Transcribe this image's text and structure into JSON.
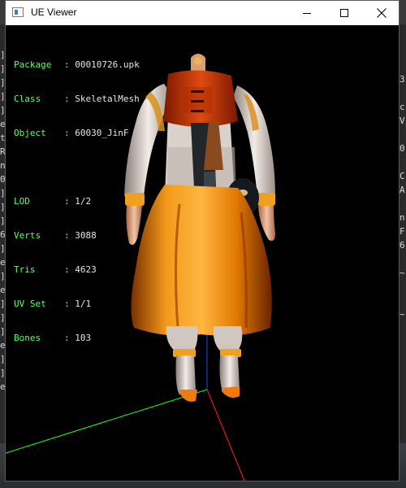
{
  "window": {
    "title": "UE Viewer"
  },
  "info": {
    "rows": [
      {
        "key": "Package",
        "value": "00010726.upk"
      },
      {
        "key": "Class",
        "value": "SkeletalMesh"
      },
      {
        "key": "Object",
        "value": "60030_JinF"
      }
    ],
    "stats": [
      {
        "key": "LOD",
        "value": "1/2"
      },
      {
        "key": "Verts",
        "value": "3088"
      },
      {
        "key": "Tris",
        "value": "4623"
      },
      {
        "key": "UV Set",
        "value": "1/1"
      },
      {
        "key": "Bones",
        "value": "103"
      }
    ]
  },
  "background_console": {
    "left_glyphs": [
      "]",
      "]",
      "]",
      "]",
      "]",
      "e",
      "t",
      "R",
      "n",
      "0",
      "]",
      "]",
      "]",
      "6",
      "]",
      "e",
      "]",
      "e",
      "]",
      "]",
      "]",
      "e",
      "]",
      "]",
      "e"
    ],
    "right_glyphs": [
      "3",
      "",
      "c",
      "V",
      "",
      "0",
      "",
      "C",
      "A",
      "",
      "n",
      "F",
      "6",
      "",
      "~",
      "",
      "",
      "~"
    ]
  },
  "colors": {
    "info_key": "#5cff5c",
    "axis_x": "#ff2020",
    "axis_y": "#20ff20",
    "axis_z": "#2040ff",
    "costume_orange": "#f08a10"
  }
}
